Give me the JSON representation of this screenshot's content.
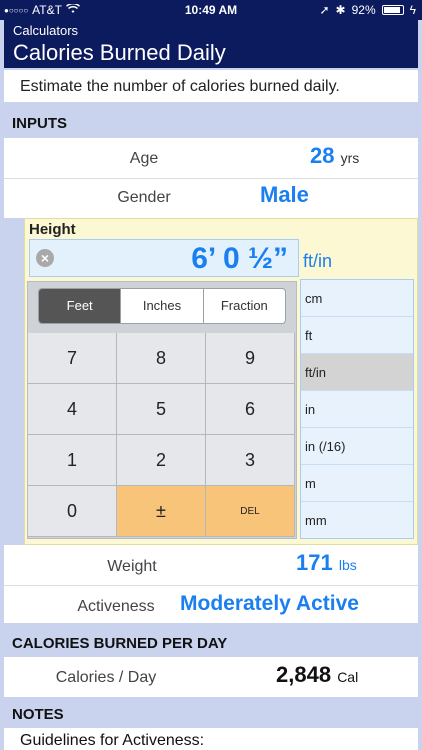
{
  "status": {
    "carrier": "AT&T",
    "time": "10:49 AM",
    "battery": "92%",
    "battery_level": 0.92
  },
  "header": {
    "breadcrumb": "Calculators",
    "title": "Calories Burned Daily"
  },
  "description": "Estimate the number of calories burned daily.",
  "inputs": {
    "section_title": "INPUTS",
    "age": {
      "label": "Age",
      "value": "28",
      "unit": "yrs"
    },
    "gender": {
      "label": "Gender",
      "value": "Male"
    },
    "height": {
      "label": "Height",
      "value": "6’ 0 ½”",
      "unit": "ft/in",
      "clear_icon": "clear-icon",
      "modes": [
        "Feet",
        "Inches",
        "Fraction"
      ],
      "active_mode": "Feet",
      "keys": [
        "7",
        "8",
        "9",
        "4",
        "5",
        "6",
        "1",
        "2",
        "3",
        "0",
        "±",
        "DEL"
      ],
      "units": [
        "cm",
        "ft",
        "ft/in",
        "in",
        "in (/16)",
        "m",
        "mm"
      ],
      "selected_unit": "ft/in"
    },
    "weight": {
      "label": "Weight",
      "value": "171",
      "unit": "lbs"
    },
    "activeness": {
      "label": "Activeness",
      "value": "Moderately Active"
    }
  },
  "results": {
    "section_title": "CALORIES BURNED PER DAY",
    "calories": {
      "label": "Calories / Day",
      "value": "2,848",
      "unit": "Cal"
    }
  },
  "notes": {
    "section_title": "NOTES",
    "text": "Guidelines for Activeness:"
  },
  "colors": {
    "header_bg": "#0c1a5e",
    "accent": "#1a7ff0",
    "page_bg": "#c9d3ee",
    "keypad_orange": "#f7c47a",
    "height_panel": "#fcf8d4"
  }
}
